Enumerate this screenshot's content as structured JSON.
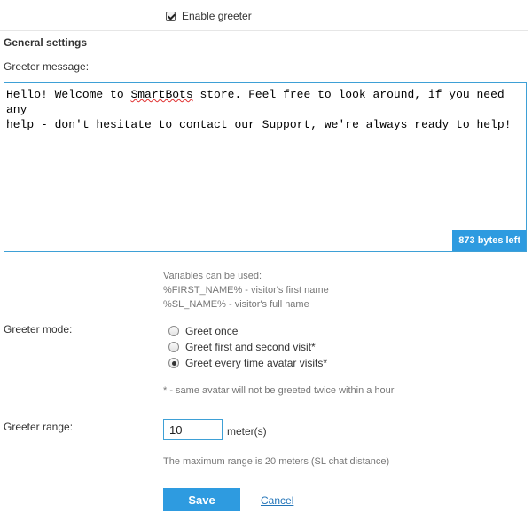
{
  "enable": {
    "label": "Enable greeter",
    "checked": true
  },
  "section_title": "General settings",
  "message": {
    "label": "Greeter message:",
    "text_before": "Hello! Welcome to ",
    "text_misspelled": "SmartBots",
    "text_after": " store. Feel free to look around, if you need any\nhelp - don't hesitate to contact our Support, we're always ready to help!",
    "bytes_left": "873 bytes left"
  },
  "variables": {
    "intro": "Variables can be used:",
    "items": [
      "%FIRST_NAME% - visitor's first name",
      "%SL_NAME% - visitor's full name"
    ]
  },
  "mode": {
    "label": "Greeter mode:",
    "options": [
      {
        "label": "Greet once",
        "selected": false
      },
      {
        "label": "Greet first and second visit*",
        "selected": false
      },
      {
        "label": "Greet every time avatar visits*",
        "selected": true
      }
    ],
    "footnote": "* - same avatar will not be greeted twice within a hour"
  },
  "range": {
    "label": "Greeter range:",
    "value": "10",
    "unit": "meter(s)",
    "note": "The maximum range is 20 meters (SL chat distance)"
  },
  "actions": {
    "save_label": "Save",
    "cancel_label": "Cancel"
  },
  "colors": {
    "accent": "#2e9be0",
    "link": "#2274b8",
    "muted": "#777777"
  }
}
